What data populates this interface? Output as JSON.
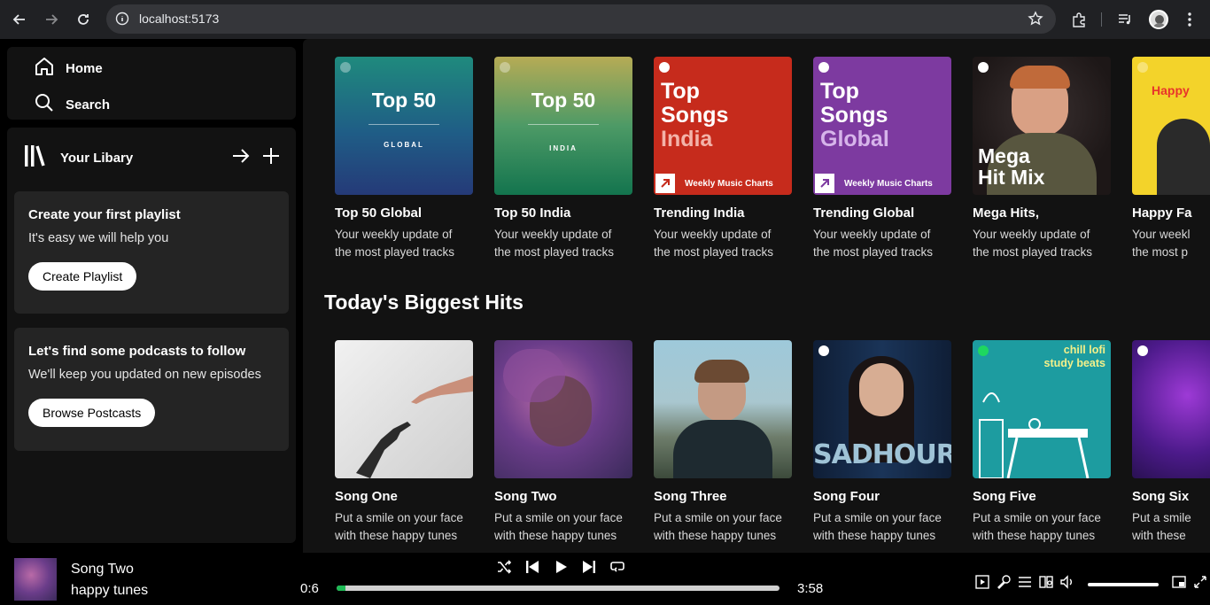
{
  "browser": {
    "url": "localhost:5173"
  },
  "sidebar": {
    "home_label": "Home",
    "search_label": "Search",
    "library_label": "Your Libary",
    "cards": [
      {
        "title": "Create your first playlist",
        "text": "It's easy we will help you",
        "button": "Create Playlist"
      },
      {
        "title": "Let's find some podcasts to follow",
        "text": "We'll keep you updated on new episodes",
        "button": "Browse Postcasts"
      }
    ]
  },
  "featured": [
    {
      "name": "Top 50 Global",
      "desc1": "Your weekly update of",
      "desc2": "the most played tracks",
      "art_title": "Top 50",
      "art_sub": "GLOBAL"
    },
    {
      "name": "Top 50 India",
      "desc1": "Your weekly update of",
      "desc2": "the most played tracks",
      "art_title": "Top 50",
      "art_sub": "INDIA"
    },
    {
      "name": "Trending India",
      "desc1": "Your weekly update of",
      "desc2": "the most played tracks",
      "art_l1": "Top",
      "art_l2": "Songs",
      "art_l3": "India",
      "art_tag": "Weekly Music Charts"
    },
    {
      "name": "Trending Global",
      "desc1": "Your weekly update of",
      "desc2": "the most played tracks",
      "art_l1": "Top",
      "art_l2": "Songs",
      "art_l3": "Global",
      "art_tag": "Weekly Music Charts"
    },
    {
      "name": "Mega Hits,",
      "desc1": "Your weekly update of",
      "desc2": "the most played tracks",
      "art_l1": "Mega",
      "art_l2": "Hit Mix"
    },
    {
      "name": "Happy Fa",
      "desc1": "Your weekl",
      "desc2": "the most p",
      "art_l1": "Happy"
    }
  ],
  "section_title": "Today's Biggest Hits",
  "songs": [
    {
      "name": "Song One",
      "desc1": "Put a smile on your face",
      "desc2": "with these happy tunes"
    },
    {
      "name": "Song Two",
      "desc1": "Put a smile on your face",
      "desc2": "with these happy tunes"
    },
    {
      "name": "Song Three",
      "desc1": "Put a smile on your face",
      "desc2": "with these happy tunes"
    },
    {
      "name": "Song Four",
      "desc1": "Put a smile on your face",
      "desc2": "with these happy tunes",
      "art_text": "SADHOUR"
    },
    {
      "name": "Song Five",
      "desc1": "Put a smile on your face",
      "desc2": "with these happy tunes",
      "art_l1": "chill lofi",
      "art_l2": "study beats"
    },
    {
      "name": "Song Six",
      "desc1": "Put a smile",
      "desc2": "with these"
    }
  ],
  "player": {
    "track": "Song Two",
    "artist": "happy tunes",
    "elapsed": "0:6",
    "duration": "3:58",
    "progress": 0.02,
    "volume": 1.0
  }
}
